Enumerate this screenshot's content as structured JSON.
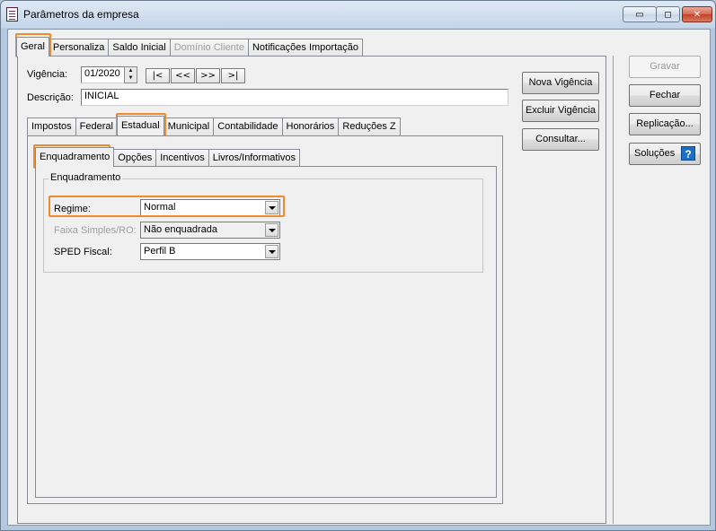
{
  "window": {
    "title": "Parâmetros da empresa",
    "controls": {
      "minimize": "▭",
      "maximize": "◻",
      "close": "✕"
    }
  },
  "main_tabs": [
    "Geral",
    "Personaliza",
    "Saldo Inicial",
    "Domínio Cliente",
    "Notificações Importação"
  ],
  "vigencia": {
    "label": "Vigência:",
    "value": "01/2020",
    "nav": [
      "|<",
      "<<",
      ">>",
      ">|"
    ]
  },
  "descricao": {
    "label": "Descrição:",
    "value": "INICIAL"
  },
  "sub_tabs": [
    "Impostos",
    "Federal",
    "Estadual",
    "Municipal",
    "Contabilidade",
    "Honorários",
    "Reduções Z"
  ],
  "inner_tabs": [
    "Enquadramento",
    "Opções",
    "Incentivos",
    "Livros/Informativos"
  ],
  "enquadramento": {
    "group_title": "Enquadramento",
    "regime": {
      "label": "Regime:",
      "value": "Normal"
    },
    "faixa": {
      "label": "Faixa Simples/RO:",
      "value": "Não enquadrada"
    },
    "sped": {
      "label": "SPED Fiscal:",
      "value": "Perfil B"
    }
  },
  "middle_buttons": {
    "nova_vigencia": "Nova Vigência",
    "excluir_vigencia": "Excluir Vigência",
    "consultar": "Consultar..."
  },
  "right_buttons": {
    "gravar": "Gravar",
    "fechar": "Fechar",
    "replicacao": "Replicação...",
    "solucoes": "Soluções",
    "help_glyph": "?"
  },
  "colors": {
    "highlight": "#f08a2a",
    "help": "#1d6fc4"
  }
}
